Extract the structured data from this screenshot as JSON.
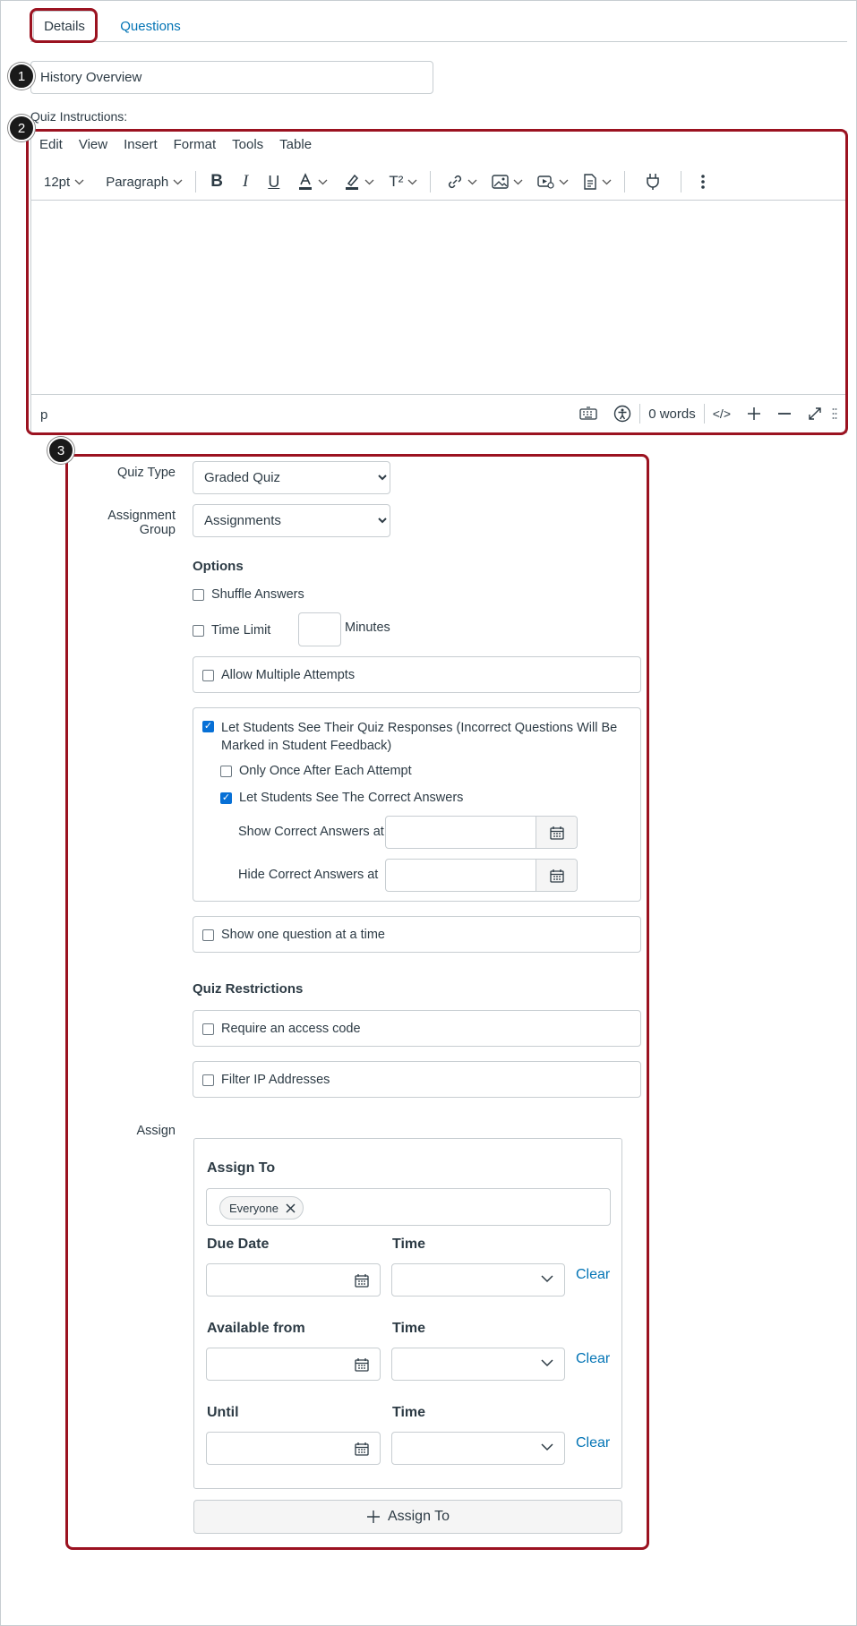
{
  "tabs": [
    {
      "label": "Details",
      "active": true
    },
    {
      "label": "Questions",
      "active": false
    }
  ],
  "callouts": [
    "1",
    "2",
    "3"
  ],
  "quiz_title": {
    "value": "History Overview"
  },
  "instructions_label": "Quiz Instructions:",
  "editor": {
    "menu": [
      "Edit",
      "View",
      "Insert",
      "Format",
      "Tools",
      "Table"
    ],
    "font_size": "12pt",
    "block_format": "Paragraph",
    "superscript_label": "T²",
    "status_tag": "p",
    "word_count": "0 words",
    "html_toggle": "</>"
  },
  "quiz_type": {
    "label": "Quiz Type",
    "selected": "Graded Quiz"
  },
  "assignment_group": {
    "label": "Assignment Group",
    "selected": "Assignments"
  },
  "options": {
    "heading": "Options",
    "shuffle_answers": {
      "label": "Shuffle Answers",
      "checked": false
    },
    "time_limit": {
      "label": "Time Limit",
      "checked": false,
      "unit": "Minutes"
    },
    "multiple_attempts": {
      "label": "Allow Multiple Attempts",
      "checked": false
    },
    "see_responses": {
      "label_line1": "Let Students See Their Quiz Responses (Incorrect Questions Will Be",
      "label_line2": "Marked in Student Feedback)",
      "checked": true
    },
    "only_once": {
      "label": "Only Once After Each Attempt",
      "checked": false
    },
    "see_correct": {
      "label": "Let Students See The Correct Answers",
      "checked": true
    },
    "show_correct_at": "Show Correct Answers at",
    "hide_correct_at": "Hide Correct Answers at",
    "one_question": {
      "label": "Show one question at a time",
      "checked": false
    }
  },
  "restrictions": {
    "heading": "Quiz Restrictions",
    "access_code": {
      "label": "Require an access code",
      "checked": false
    },
    "filter_ip": {
      "label": "Filter IP Addresses",
      "checked": false
    }
  },
  "assign": {
    "label": "Assign",
    "assign_to_heading": "Assign To",
    "assignee": "Everyone",
    "due_date": "Due Date",
    "available_from": "Available from",
    "until": "Until",
    "time": "Time",
    "clear": "Clear",
    "add_button": "Assign To"
  },
  "colors": {
    "highlight": "#9b1220",
    "link": "#0374b5",
    "checkbox": "#0770d6"
  }
}
